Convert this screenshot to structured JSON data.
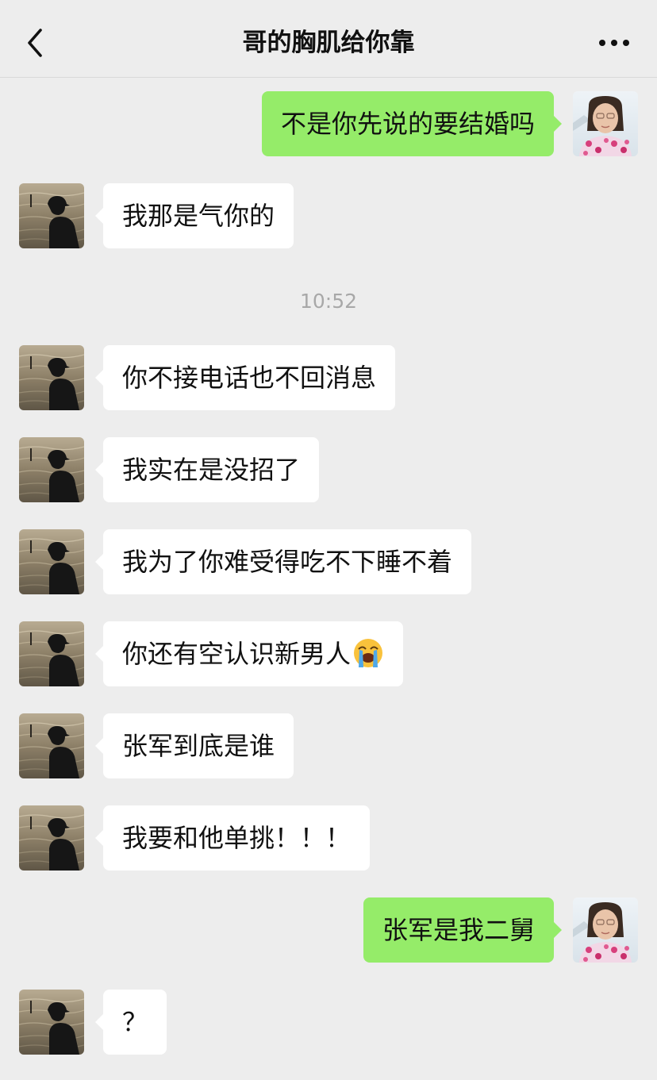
{
  "header": {
    "title": "哥的胸肌给你靠",
    "back_icon": "chevron-left-icon",
    "more_icon": "ellipsis-icon"
  },
  "colors": {
    "background": "#ededed",
    "sent_bubble": "#95ec69",
    "received_bubble": "#ffffff",
    "timestamp_text": "#a8a8a8"
  },
  "messages": [
    {
      "side": "right",
      "text": "不是你先说的要结婚吗"
    },
    {
      "side": "left",
      "text": "我那是气你的"
    },
    {
      "type": "time",
      "text": "10:52"
    },
    {
      "side": "left",
      "text": "你不接电话也不回消息"
    },
    {
      "side": "left",
      "text": "我实在是没招了"
    },
    {
      "side": "left",
      "text": "我为了你难受得吃不下睡不着"
    },
    {
      "side": "left",
      "text": "你还有空认识新男人",
      "emoji": "loudly-crying-face-icon"
    },
    {
      "side": "left",
      "text": "张军到底是谁"
    },
    {
      "side": "left",
      "text": "我要和他单挑！！！"
    },
    {
      "side": "right",
      "text": "张军是我二舅"
    },
    {
      "side": "left",
      "text": "？"
    }
  ]
}
